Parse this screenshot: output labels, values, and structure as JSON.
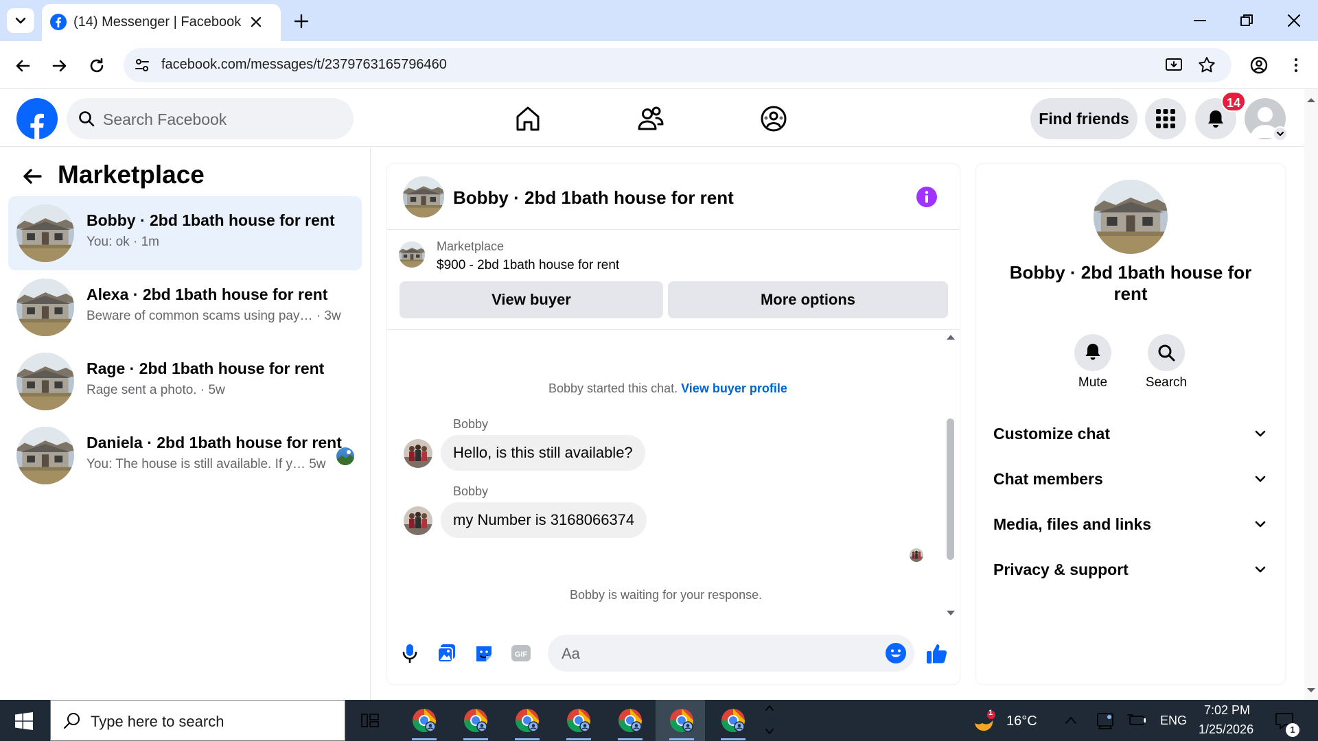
{
  "browser": {
    "tab_title": "(14) Messenger | Facebook",
    "url": "facebook.com/messages/t/2379763165796460"
  },
  "header": {
    "search_placeholder": "Search Facebook",
    "find_friends": "Find friends",
    "notification_count": "14"
  },
  "sidebar": {
    "title": "Marketplace",
    "conversations": [
      {
        "name": "Bobby · 2bd 1bath house for rent",
        "preview": "You: ok · 1m",
        "active": true
      },
      {
        "name": "Alexa · 2bd 1bath house for rent",
        "preview": "Beware of common scams using pay…  · 3w",
        "active": false
      },
      {
        "name": "Rage · 2bd 1bath house for rent",
        "preview": "Rage sent a photo. · 5w",
        "active": false
      },
      {
        "name": "Daniela · 2bd 1bath house for rent",
        "preview": "You: The house is still available. If y…  5w",
        "active": false
      }
    ]
  },
  "chat": {
    "title": "Bobby · 2bd 1bath house for rent",
    "listing_label": "Marketplace",
    "listing_price": "$900 - 2bd 1bath house for rent",
    "view_buyer": "View buyer",
    "more_options": "More options",
    "started_text": "Bobby started this chat.",
    "view_buyer_profile": "View buyer profile",
    "messages": [
      {
        "sender": "Bobby",
        "text": "Hello, is this still available?"
      },
      {
        "sender": "Bobby",
        "text": "my Number is 3168066374"
      }
    ],
    "waiting_text": "Bobby is waiting for your response.",
    "composer_placeholder": "Aa"
  },
  "details": {
    "name": "Bobby · 2bd 1bath house for rent",
    "mute": "Mute",
    "search": "Search",
    "sections": [
      "Customize chat",
      "Chat members",
      "Media, files and links",
      "Privacy & support"
    ]
  },
  "taskbar": {
    "search_placeholder": "Type here to search",
    "weather": "16°C",
    "weather_badge": "1",
    "language": "ENG",
    "time": "7:02 PM",
    "date": "1/25/2026",
    "notification_count": "1"
  },
  "colors": {
    "facebook_blue": "#0866ff",
    "messenger_purple": "#a033ff",
    "active_conversation": "#e8f1fc",
    "badge_red": "#e41e3f"
  }
}
